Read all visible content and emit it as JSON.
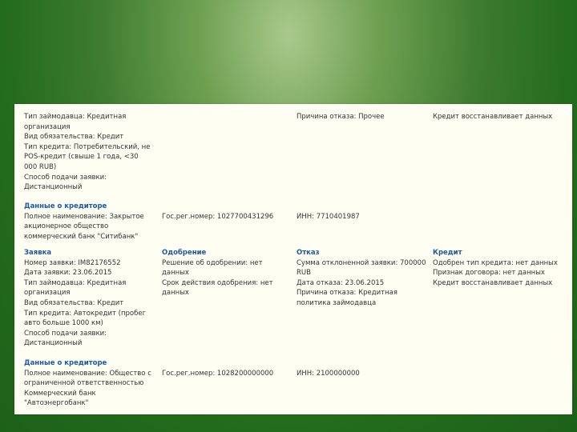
{
  "block1": {
    "col1": [
      "Тип займодавца: Кредитная организация",
      "Вид обязательства: Кредит",
      "Тип кредита: Потребительский, не POS-кредит (свыше 1 года, <30 000 RUB)",
      "Способ подачи заявки: Дистанционный"
    ],
    "col3": "Причина отказа: Прочее",
    "col4": "Кредит восстанавливает данных"
  },
  "creditor1": {
    "heading": "Данные о кредиторе",
    "full_name": "Полное наименование: Закрытое акционерное общество коммерческий банк \"Ситибанк\"",
    "reg_number": "Гос.рег.номер: 1027700431296",
    "inn": "ИНН: 7710401987"
  },
  "block2": {
    "headers": {
      "application": "Заявка",
      "approval": "Одобрение",
      "refusal": "Отказ",
      "credit": "Кредит"
    },
    "application": [
      "Номер заявки: IM82176552",
      "Дата заявки: 23.06.2015",
      "Тип займодавца: Кредитная организация",
      "Вид обязательства: Кредит",
      "Тип кредита: Автокредит (пробег авто больше 1000 км)",
      "Способ подачи заявки: Дистанционный"
    ],
    "approval": [
      "Решение об одобрении: нет данных",
      "Срок действия одобрения: нет данных"
    ],
    "refusal": [
      "Сумма отклоненной заявки: 700000 RUB",
      "Дата отказа: 23.06.2015",
      "Причина отказа: Кредитная политика займодавца"
    ],
    "credit": [
      "Одобрен тип кредита: нет данных",
      "Признак договора: нет данных",
      "Кредит восстанавливает данных"
    ]
  },
  "creditor2": {
    "heading": "Данные о кредиторе",
    "full_name": "Полное наименование: Общество с ограниченной ответственностью Коммерческий банк \"Автоэнергобанк\"",
    "reg_number": "Гос.рег.номер: 1028200000000",
    "inn": "ИНН: 2100000000"
  }
}
